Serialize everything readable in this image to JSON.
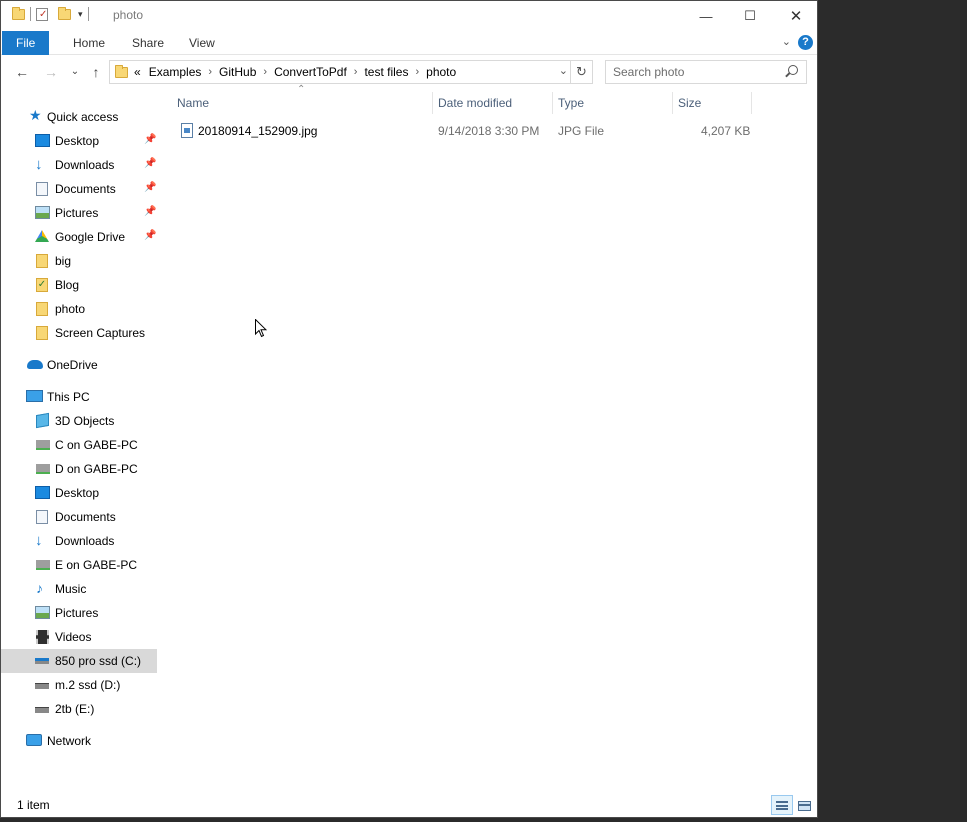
{
  "title": {
    "text": "photo",
    "minimize": "—",
    "maximize": "☐",
    "close": "✕"
  },
  "ribbon": {
    "tabs": [
      "File",
      "Home",
      "Share",
      "View"
    ],
    "help": "?"
  },
  "address": {
    "overflow": "«",
    "crumbs": [
      "Examples",
      "GitHub",
      "ConvertToPdf",
      "test files",
      "photo"
    ]
  },
  "search": {
    "placeholder": "Search photo"
  },
  "sidebar": {
    "quick_access": {
      "label": "Quick access",
      "items": [
        {
          "label": "Desktop",
          "icon": "desktop-icon",
          "pinned": true
        },
        {
          "label": "Downloads",
          "icon": "downloads-icon",
          "pinned": true
        },
        {
          "label": "Documents",
          "icon": "documents-icon",
          "pinned": true
        },
        {
          "label": "Pictures",
          "icon": "pictures-icon",
          "pinned": true
        },
        {
          "label": "Google Drive",
          "icon": "google-drive-icon",
          "pinned": true
        },
        {
          "label": "big",
          "icon": "folder-icon",
          "pinned": false
        },
        {
          "label": "Blog",
          "icon": "folder-icon",
          "pinned": false
        },
        {
          "label": "photo",
          "icon": "folder-icon",
          "pinned": false
        },
        {
          "label": "Screen Captures",
          "icon": "folder-icon",
          "pinned": false
        }
      ]
    },
    "onedrive": {
      "label": "OneDrive"
    },
    "this_pc": {
      "label": "This PC",
      "items": [
        {
          "label": "3D Objects",
          "icon": "3d-objects-icon"
        },
        {
          "label": "C on GABE-PC",
          "icon": "network-drive-icon"
        },
        {
          "label": "D on GABE-PC",
          "icon": "network-drive-icon"
        },
        {
          "label": "Desktop",
          "icon": "desktop-icon"
        },
        {
          "label": "Documents",
          "icon": "documents-icon"
        },
        {
          "label": "Downloads",
          "icon": "downloads-icon"
        },
        {
          "label": "E on GABE-PC",
          "icon": "network-drive-icon"
        },
        {
          "label": "Music",
          "icon": "music-icon"
        },
        {
          "label": "Pictures",
          "icon": "pictures-icon"
        },
        {
          "label": "Videos",
          "icon": "videos-icon"
        },
        {
          "label": "850 pro ssd (C:)",
          "icon": "drive-icon",
          "selected": true
        },
        {
          "label": "m.2 ssd (D:)",
          "icon": "drive-icon"
        },
        {
          "label": "2tb (E:)",
          "icon": "drive-icon"
        }
      ]
    },
    "network": {
      "label": "Network"
    }
  },
  "columns": {
    "name": "Name",
    "date_modified": "Date modified",
    "type": "Type",
    "size": "Size"
  },
  "files": [
    {
      "name": "20180914_152909.jpg",
      "date_modified": "9/14/2018 3:30 PM",
      "type": "JPG File",
      "size": "4,207 KB"
    }
  ],
  "status": {
    "item_count": "1 item"
  },
  "colors": {
    "accent": "#1979ca",
    "selected_nav": "#d9d9d9",
    "header_text": "#4c607a"
  }
}
